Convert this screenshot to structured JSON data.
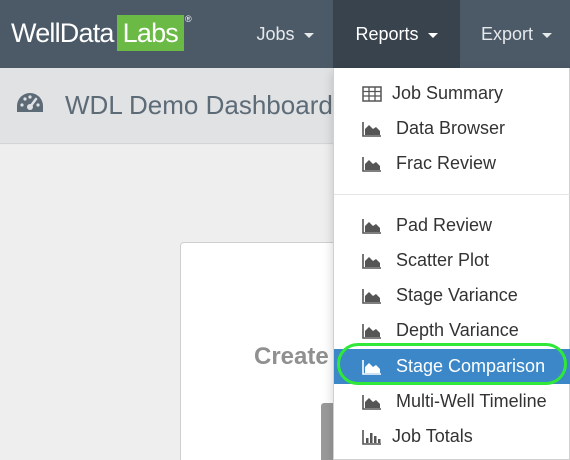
{
  "logo": {
    "part1": "WellData",
    "part2": "Labs",
    "reg": "®"
  },
  "nav": {
    "jobs": "Jobs",
    "reports": "Reports",
    "export": "Export"
  },
  "page": {
    "title": "WDL Demo Dashboard"
  },
  "card": {
    "title": "Create"
  },
  "reports_menu": {
    "group1": [
      {
        "label": "Job Summary",
        "icon": "table-icon"
      },
      {
        "label": "Data Browser",
        "icon": "area-chart-icon"
      },
      {
        "label": "Frac Review",
        "icon": "area-chart-icon"
      }
    ],
    "group2": [
      {
        "label": "Pad Review",
        "icon": "area-chart-icon"
      },
      {
        "label": "Scatter Plot",
        "icon": "area-chart-icon"
      },
      {
        "label": "Stage Variance",
        "icon": "area-chart-icon"
      },
      {
        "label": "Depth Variance",
        "icon": "area-chart-icon"
      },
      {
        "label": "Stage Comparison",
        "icon": "area-chart-icon",
        "highlighted": true
      },
      {
        "label": "Multi-Well Timeline",
        "icon": "area-chart-icon"
      },
      {
        "label": "Job Totals",
        "icon": "bar-chart-icon"
      }
    ]
  },
  "colors": {
    "navbar": "#4c5a67",
    "brand_green": "#6aba45",
    "highlight": "#3b87c7",
    "annotation_ring": "#2fe83a"
  }
}
